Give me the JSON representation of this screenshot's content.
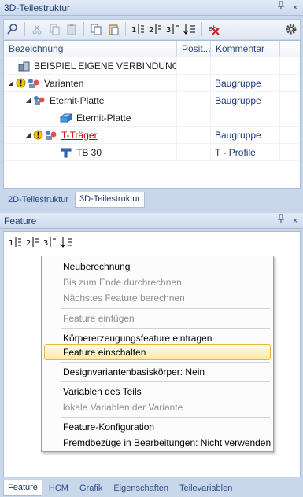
{
  "top_panel": {
    "title": "3D-Teilestruktur",
    "pin": "ᅲ",
    "close": "×"
  },
  "tree": {
    "columns": [
      "Bezeichnung",
      "Posit...",
      "Kommentar"
    ],
    "rows": [
      {
        "label": "BEISPIEL EIGENE VERBINDUNG",
        "comment": ""
      },
      {
        "label": "Varianten",
        "comment": "Baugruppe"
      },
      {
        "label": "Eternit-Platte",
        "comment": "Baugruppe"
      },
      {
        "label": "Eternit-Platte",
        "comment": ""
      },
      {
        "label": "T-Träger",
        "comment": "Baugruppe"
      },
      {
        "label": "TB 30",
        "comment": "T - Profile"
      }
    ]
  },
  "top_tabs": [
    "2D-Teilestruktur",
    "3D-Teilestruktur"
  ],
  "feature_panel": {
    "title": "Feature",
    "toolbar_numbers": [
      "1",
      "2",
      "3"
    ]
  },
  "context_menu": {
    "items": [
      {
        "label": "Neuberechnung",
        "enabled": true
      },
      {
        "label": "Bis zum Ende durchrechnen",
        "enabled": false
      },
      {
        "label": "Nächstes Feature berechnen",
        "enabled": false
      },
      {
        "label": "Feature einfügen",
        "enabled": false
      },
      {
        "label": "Körpererzeugungsfeature eintragen",
        "enabled": true
      },
      {
        "label": "Feature einschalten",
        "enabled": true
      },
      {
        "label": "Designvariantenbasiskörper:  Nein",
        "enabled": true
      },
      {
        "label": "Variablen des Teils",
        "enabled": true
      },
      {
        "label": "lokale Variablen der Variante",
        "enabled": false
      },
      {
        "label": "Feature-Konfiguration",
        "enabled": true
      },
      {
        "label": "Fremdbezüge in Bearbeitungen: Nicht verwenden",
        "enabled": true
      }
    ]
  },
  "bottom_tabs": [
    "Feature",
    "HCM",
    "Grafik",
    "Eigenschaften",
    "Teilevariablen"
  ],
  "colors": {
    "warning": "#f2c200",
    "error_text": "#c00000",
    "accent": "#2d4e86"
  }
}
